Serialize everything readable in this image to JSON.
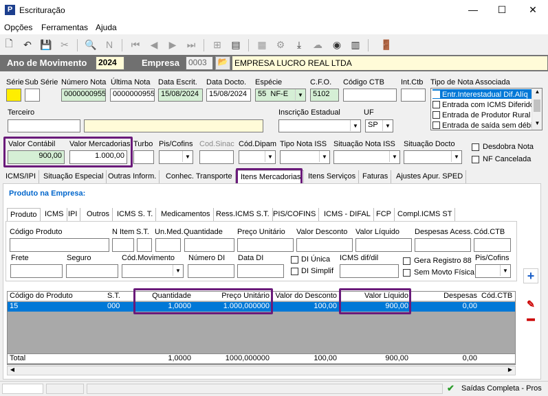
{
  "window": {
    "title": "Escrituração",
    "min": "—",
    "max": "☐",
    "close": "✕"
  },
  "menu": [
    "Opções",
    "Ferramentas",
    "Ajuda"
  ],
  "header": {
    "ano_label": "Ano de Movimento",
    "ano_value": "2024",
    "empresa_label": "Empresa",
    "empresa_code": "0003",
    "empresa_name": "EMPRESA LUCRO REAL LTDA"
  },
  "fields": {
    "serie_label": "Série",
    "subserie_label": "Sub Série",
    "numero_label": "Número Nota",
    "numero_value": "0000000955",
    "ultima_label": "Última Nota",
    "ultima_value": "0000000955",
    "data_escrit_label": "Data Escrit.",
    "data_escrit_value": "15/08/2024",
    "data_docto_label": "Data Docto.",
    "data_docto_value": "15/08/2024",
    "especie_label": "Espécie",
    "especie_code": "55",
    "especie_value": "NF-E",
    "cfo_label": "C.F.O.",
    "cfo_value": "5102",
    "codigo_ctb_label": "Código CTB",
    "int_ctb_label": "Int.Ctb",
    "tipo_nota_label": "Tipo de Nota Associada",
    "terceiro_label": "Terceiro",
    "inscricao_label": "Inscrição Estadual",
    "uf_label": "UF",
    "uf_value": "SP",
    "valor_contabil_label": "Valor Contábil",
    "valor_contabil_value": "900,00",
    "valor_merc_label": "Valor Mercadorias",
    "valor_merc_value": "1.000,00",
    "turbo_label": "Turbo",
    "pis_label": "Pis/Cofins",
    "cod_sinac_label": "Cod.Sinac",
    "cod_dipam_label": "Cód.Dipam",
    "tipo_iss_label": "Tipo Nota ISS",
    "sit_iss_label": "Situação Nota ISS",
    "sit_docto_label": "Situação Docto",
    "desdobra_label": "Desdobra Nota",
    "cancelada_label": "NF Cancelada"
  },
  "tipo_nota_options": [
    "Entr.Interestadual Dif.Alíq",
    "Entrada com ICMS Diferido",
    "Entrada de Produtor Rural",
    "Entrada de saída sem débi"
  ],
  "main_tabs": [
    "ICMS/IPI",
    "Situação Especial",
    "Outras Inform.",
    "Conhec. Transporte",
    "Itens Mercadorias",
    "Itens Serviços",
    "Faturas",
    "Ajustes Apur. SPED"
  ],
  "produto_title": "Produto na Empresa:",
  "sub_tabs": [
    "Produto",
    "ICMS",
    "IPI",
    "Outros",
    "ICMS S. T.",
    "Medicamentos",
    "Ress.ICMS S.T.",
    "PIS/COFINS",
    "ICMS - DIFAL",
    "FCP",
    "Compl.ICMS ST"
  ],
  "produto": {
    "codigo_label": "Código Produto",
    "nitem_label": "N Item",
    "st_label": "S.T.",
    "unmed_label": "Un.Med.",
    "quantidade_label": "Quantidade",
    "preco_label": "Preço Unitário",
    "desconto_label": "Valor Desconto",
    "liquido_label": "Valor Líquido",
    "despesas_label": "Despesas Acess.",
    "codctb_label": "Cód.CTB",
    "frete_label": "Frete",
    "seguro_label": "Seguro",
    "codmov_label": "Cód.Movimento",
    "numdi_label": "Número DI",
    "datadi_label": "Data DI",
    "diunica_label": "DI Única",
    "disimplif_label": "DI Simplif",
    "icmsdif_label": "ICMS dif/dil",
    "gera_label": "Gera Registro 88",
    "semmovto_label": "Sem Movto Física",
    "piscofins_label": "Pis/Cofins"
  },
  "grid": {
    "headers": [
      "Código do Produto",
      "S.T.",
      "Quantidade",
      "Preço Unitário",
      "Valor do Desconto",
      "Valor Líquido",
      "Despesas",
      "Cód.CTB"
    ],
    "row": [
      "15",
      "000",
      "1,0000",
      "1.000,000000",
      "100,00",
      "900,00",
      "0,00",
      ""
    ],
    "total": [
      "Total",
      "",
      "1,0000",
      "1000,000000",
      "100,00",
      "900,00",
      "0,00",
      ""
    ]
  },
  "status": {
    "text": "Saídas Completa - Pros"
  }
}
